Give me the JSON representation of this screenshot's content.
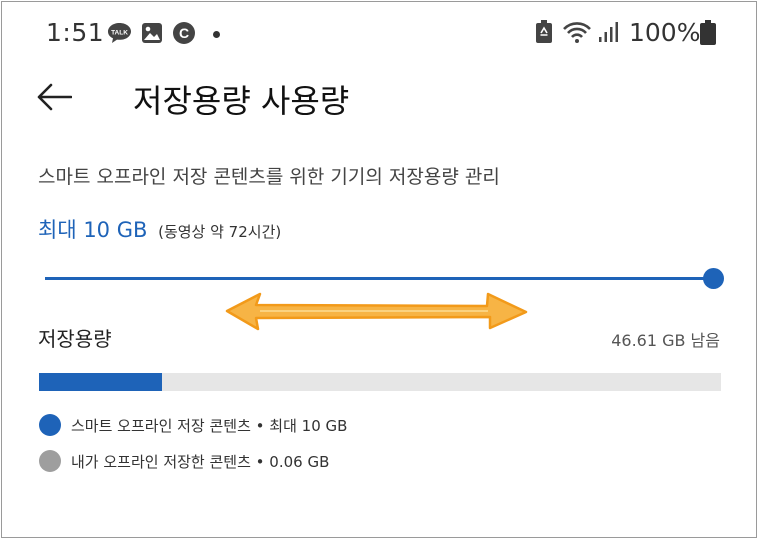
{
  "status_bar": {
    "time": "1:51",
    "talk_icon_text": "TALK",
    "c_icon_text": "C",
    "battery_percent": "100%"
  },
  "header": {
    "title": "저장용량 사용량"
  },
  "description": "스마트 오프라인 저장 콘텐츠를 위한 기기의 저장용량 관리",
  "max_setting": {
    "value": "최대 10 GB",
    "sub": "(동영상 약 72시간)"
  },
  "slider": {
    "level": 1.0
  },
  "storage": {
    "label": "저장용량",
    "remaining": "46.61 GB 남음",
    "used_fraction": 0.18
  },
  "legend": [
    {
      "label": "스마트 오프라인 저장 콘텐츠 • 최대 10 GB",
      "color": "#1e63b8"
    },
    {
      "label": "내가 오프라인 저장한 콘텐츠 • 0.06 GB",
      "color": "#9e9e9e"
    }
  ],
  "annotation": {
    "color": "#f5a623"
  }
}
